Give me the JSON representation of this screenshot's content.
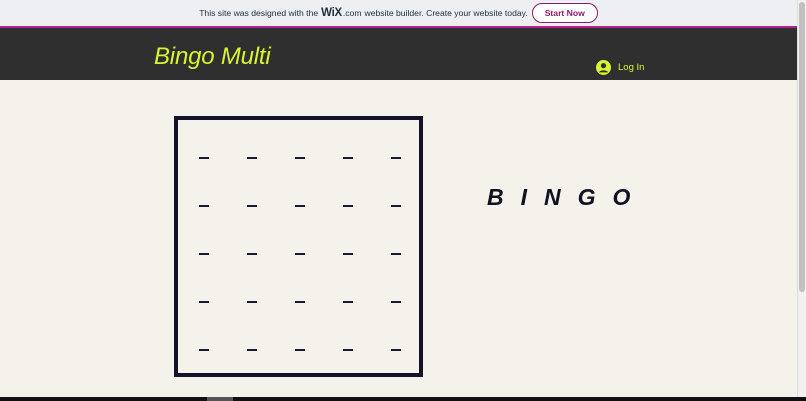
{
  "banner": {
    "text_before": "This site was designed with the",
    "wix_logo": "WiX",
    "wix_suffix": ".com",
    "text_after": "website builder. Create your website today.",
    "button_label": "Start Now"
  },
  "header": {
    "site_title": "Bingo Multi",
    "login_label": "Log In",
    "login_icon": "user-avatar-icon"
  },
  "board": {
    "rows": 5,
    "cols": 5,
    "cells": [
      [
        "",
        "",
        "",
        "",
        ""
      ],
      [
        "",
        "",
        "",
        "",
        ""
      ],
      [
        "",
        "",
        "",
        "",
        ""
      ],
      [
        "",
        "",
        "",
        "",
        ""
      ],
      [
        "",
        "",
        "",
        "",
        ""
      ]
    ]
  },
  "bingo_word": "BINGO",
  "colors": {
    "accent": "#d8f52e",
    "header_bg": "#2f2f2f",
    "page_bg": "#f5f2ec",
    "board_border": "#131229",
    "wix_brand": "#8a1a6c"
  }
}
